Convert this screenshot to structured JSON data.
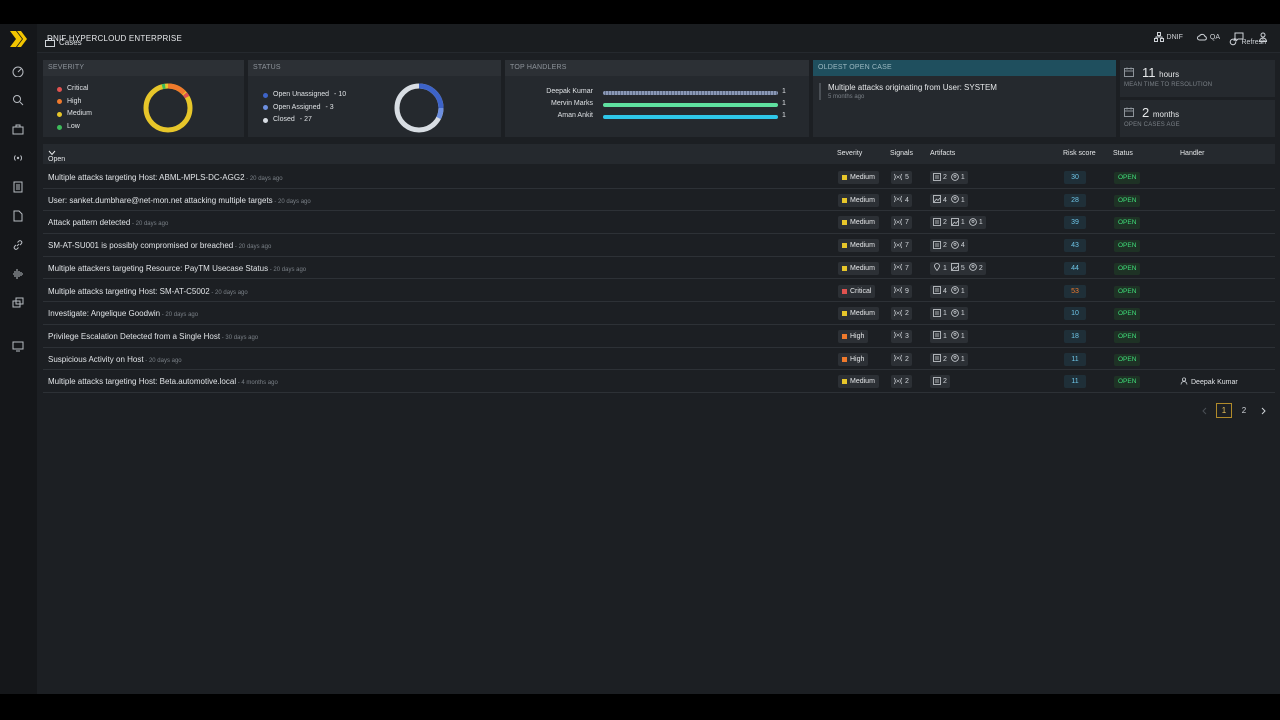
{
  "app": {
    "title": "DNIF HYPERCLOUD ENTERPRISE"
  },
  "topbar": {
    "org_label": "DNIF",
    "env_label": "QA"
  },
  "page": {
    "breadcrumb": "Cases",
    "refresh_label": "Refresh"
  },
  "severity_card": {
    "title": "SEVERITY",
    "items": [
      {
        "label": "Critical",
        "color": "#e0524f"
      },
      {
        "label": "High",
        "color": "#f07a2c"
      },
      {
        "label": "Medium",
        "color": "#e7c62a"
      },
      {
        "label": "Low",
        "color": "#3dbb5a"
      }
    ]
  },
  "status_card": {
    "title": "STATUS",
    "items": [
      {
        "label": "Open Unassigned",
        "count": "- 10",
        "color": "#3d63c8"
      },
      {
        "label": "Open Assigned",
        "count": "- 3",
        "color": "#6d8fe0"
      },
      {
        "label": "Closed",
        "count": "- 27",
        "color": "#d8dde3"
      }
    ]
  },
  "handlers_card": {
    "title": "TOP HANDLERS",
    "items": [
      {
        "name": "Deepak Kumar",
        "count": "1",
        "color": "#8a98b5"
      },
      {
        "name": "Mervin Marks",
        "count": "1",
        "color": "#5fe0a0"
      },
      {
        "name": "Aman Ankit",
        "count": "1",
        "color": "#2ec6e8"
      }
    ]
  },
  "oldest_card": {
    "title": "OLDEST OPEN CASE",
    "case_title": "Multiple attacks originating from User: SYSTEM",
    "age": "5 months ago"
  },
  "metrics": {
    "mttr_value": "11",
    "mttr_unit": "hours",
    "mttr_label": "MEAN TIME TO RESOLUTION",
    "age_value": "2",
    "age_unit": "months",
    "age_label": "OPEN CASES AGE"
  },
  "table": {
    "filter_label": "Open",
    "columns": {
      "severity": "Severity",
      "signals": "Signals",
      "artifacts": "Artifacts",
      "risk": "Risk score",
      "status": "Status",
      "handler": "Handler"
    },
    "rows": [
      {
        "title": "Multiple attacks targeting Host: ABML-MPLS-DC-AGG2",
        "ago": " - 20 days ago",
        "severity": "Medium",
        "sev_color": "#e7c62a",
        "signals": "5",
        "artifacts": [
          [
            "doc",
            "2"
          ],
          [
            "user",
            "1"
          ]
        ],
        "risk": "30",
        "risk_color": "#6fc6e8",
        "status": "OPEN",
        "handler": ""
      },
      {
        "title": "User: sanket.dumbhare@net-mon.net attacking multiple targets",
        "ago": " - 20 days ago",
        "severity": "Medium",
        "sev_color": "#e7c62a",
        "signals": "4",
        "artifacts": [
          [
            "img",
            "4"
          ],
          [
            "user",
            "1"
          ]
        ],
        "risk": "28",
        "risk_color": "#6fc6e8",
        "status": "OPEN",
        "handler": ""
      },
      {
        "title": "Attack pattern detected",
        "ago": " - 20 days ago",
        "severity": "Medium",
        "sev_color": "#e7c62a",
        "signals": "7",
        "artifacts": [
          [
            "doc",
            "2"
          ],
          [
            "img",
            "1"
          ],
          [
            "user",
            "1"
          ]
        ],
        "risk": "39",
        "risk_color": "#6fc6e8",
        "status": "OPEN",
        "handler": ""
      },
      {
        "title": "SM-AT-SU001 is possibly compromised or breached",
        "ago": " - 20 days ago",
        "severity": "Medium",
        "sev_color": "#e7c62a",
        "signals": "7",
        "artifacts": [
          [
            "doc",
            "2"
          ],
          [
            "user",
            "4"
          ]
        ],
        "risk": "43",
        "risk_color": "#6fc6e8",
        "status": "OPEN",
        "handler": ""
      },
      {
        "title": "Multiple attackers targeting Resource: PayTM Usecase Status",
        "ago": " - 20 days ago",
        "severity": "Medium",
        "sev_color": "#e7c62a",
        "signals": "7",
        "artifacts": [
          [
            "pin",
            "1"
          ],
          [
            "img",
            "5"
          ],
          [
            "user",
            "2"
          ]
        ],
        "risk": "44",
        "risk_color": "#6fc6e8",
        "status": "OPEN",
        "handler": ""
      },
      {
        "title": "Multiple attacks targeting Host: SM-AT-C5002",
        "ago": " - 20 days ago",
        "severity": "Critical",
        "sev_color": "#e0524f",
        "signals": "9",
        "artifacts": [
          [
            "doc",
            "4"
          ],
          [
            "user",
            "1"
          ]
        ],
        "risk": "53",
        "risk_color": "#f07a2c",
        "status": "OPEN",
        "handler": ""
      },
      {
        "title": "Investigate: Angelique Goodwin",
        "ago": " - 20 days ago",
        "severity": "Medium",
        "sev_color": "#e7c62a",
        "signals": "2",
        "artifacts": [
          [
            "doc",
            "1"
          ],
          [
            "user",
            "1"
          ]
        ],
        "risk": "10",
        "risk_color": "#6fc6e8",
        "status": "OPEN",
        "handler": ""
      },
      {
        "title": "Privilege Escalation Detected from a  Single Host",
        "ago": " - 30 days ago",
        "severity": "High",
        "sev_color": "#f07a2c",
        "signals": "3",
        "artifacts": [
          [
            "doc",
            "1"
          ],
          [
            "user",
            "1"
          ]
        ],
        "risk": "18",
        "risk_color": "#6fc6e8",
        "status": "OPEN",
        "handler": ""
      },
      {
        "title": "Suspicious Activity on Host",
        "ago": " - 20 days ago",
        "severity": "High",
        "sev_color": "#f07a2c",
        "signals": "2",
        "artifacts": [
          [
            "doc",
            "2"
          ],
          [
            "user",
            "1"
          ]
        ],
        "risk": "11",
        "risk_color": "#6fc6e8",
        "status": "OPEN",
        "handler": ""
      },
      {
        "title": "Multiple attacks targeting Host: Beta.automotive.local",
        "ago": " - 4 months ago",
        "severity": "Medium",
        "sev_color": "#e7c62a",
        "signals": "2",
        "artifacts": [
          [
            "doc",
            "2"
          ]
        ],
        "risk": "11",
        "risk_color": "#6fc6e8",
        "status": "OPEN",
        "handler": "Deepak Kumar"
      }
    ]
  },
  "pagination": {
    "pages": [
      "1",
      "2"
    ],
    "active": "1"
  }
}
